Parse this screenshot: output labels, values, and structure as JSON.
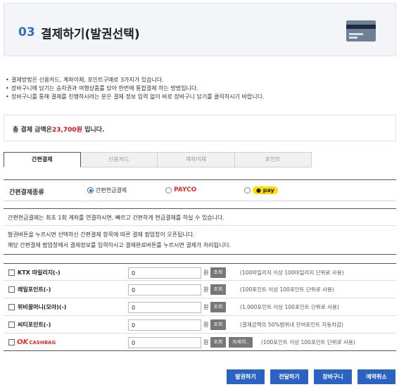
{
  "header": {
    "step_num": "03",
    "title": "결제하기(발권선택)",
    "icon": "credit-card-icon"
  },
  "notes": [
    "결제방법은 신용카드, 계좌이체, 포인트구매로 3가지가 있습니다.",
    "장바구니에 담기는 승차권과 여행상품를 담아 한번에 통합결제 하는 방법입니다.",
    "장바구니를 통해 결제를 진행하시려는 분은 결제 정보 입력 없이 바로 장바구니 담기를 클릭하시기 바랍니다."
  ],
  "total": {
    "prefix": "총 결제 금액은",
    "amount": "23,700원",
    "suffix": " 입니다."
  },
  "tabs": [
    "간편결제",
    "신용카드",
    "계좌이체",
    "포인트"
  ],
  "easy_pay": {
    "label": "간편결제종류",
    "options": [
      {
        "label": "간편현금결제",
        "selected": true
      },
      {
        "label": "PAYCO",
        "selected": false
      },
      {
        "label": "pay",
        "selected": false
      }
    ]
  },
  "desc": {
    "line1": "간편현금결제는 최초 1회 계좌를 연결하시면, 빠르고 간편하게 현금결제를 하실 수 있습니다.",
    "line2": "발권버튼을 누르시면 선택하신 간편결제 항목에 따른 결제 팝업창이 오픈됩니다.",
    "line3": "해당 간편결제 팝업창에서 결제정보를 입력하시고 결제완료버튼를 누르시면 결제가 처리됩니다."
  },
  "points": [
    {
      "label": "KTX 마일리지(-)",
      "value": "0",
      "unit": "원",
      "btn": "조회",
      "hint": "(100마일리지 이상 100마일리지 단위로 사용)"
    },
    {
      "label": "레일포인트(-)",
      "value": "0",
      "unit": "원",
      "btn": "조회",
      "hint": "(100포인트 이상 100포인트 단위로 사용)"
    },
    {
      "label": "위비꿀머니(모아)(-)",
      "value": "0",
      "unit": "원",
      "btn": "조회",
      "hint": "(1,000포인트 이상 100포인트 단위로 사용)"
    },
    {
      "label": "씨티포인트(-)",
      "value": "0",
      "unit": "원",
      "btn": "조회",
      "hint": "(결제금액의 50%범위내 잔여포인트 자동차감)"
    },
    {
      "label_ok": "OK",
      "label_cb": "CASHBAG",
      "value": "0",
      "unit": "원",
      "btn": "조회",
      "btn2": "자세히..",
      "hint": "(100포인트 이상 100포인트 단위로 사용)"
    }
  ],
  "actions": [
    "발권하기",
    "전달하기",
    "장바구니",
    "예약취소"
  ]
}
